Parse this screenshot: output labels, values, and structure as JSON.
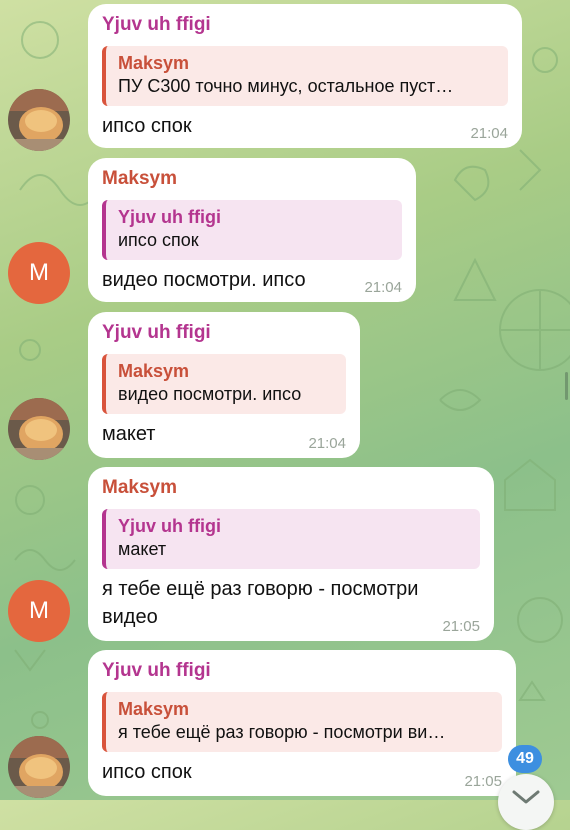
{
  "messages": [
    {
      "sender": "Yjuv uh ffigi",
      "reply_name": "Maksym",
      "reply_text": "ПУ С300 точно минус, остальное пуст…",
      "text": "ипсо спок",
      "time": "21:04"
    },
    {
      "sender": "Maksym",
      "reply_name": "Yjuv uh ffigi",
      "reply_text": "ипсо спок",
      "text": "видео посмотри. ипсо",
      "time": "21:04"
    },
    {
      "sender": "Yjuv uh ffigi",
      "reply_name": "Maksym",
      "reply_text": "видео посмотри. ипсо",
      "text": "макет",
      "time": "21:04"
    },
    {
      "sender": "Maksym",
      "reply_name": "Yjuv uh ffigi",
      "reply_text": "макет",
      "text_line1": "я тебе ещё раз говорю - посмотри",
      "text_line2": "видео",
      "time": "21:05"
    },
    {
      "sender": "Yjuv uh ffigi",
      "reply_name": "Maksym",
      "reply_text": "я тебе ещё раз говорю - посмотри ви…",
      "text": "ипсо спок",
      "time": "21:05"
    }
  ],
  "avatar_letter": "M",
  "unread_badge": "49",
  "icons": {
    "avatar_photo": "bread-photo-icon",
    "scroll_down": "chevron-down-icon"
  },
  "colors": {
    "purple_name": "#b4358f",
    "red_name": "#c8503a",
    "badge": "#3d8fe0",
    "avatar_m": "#e4673e"
  }
}
